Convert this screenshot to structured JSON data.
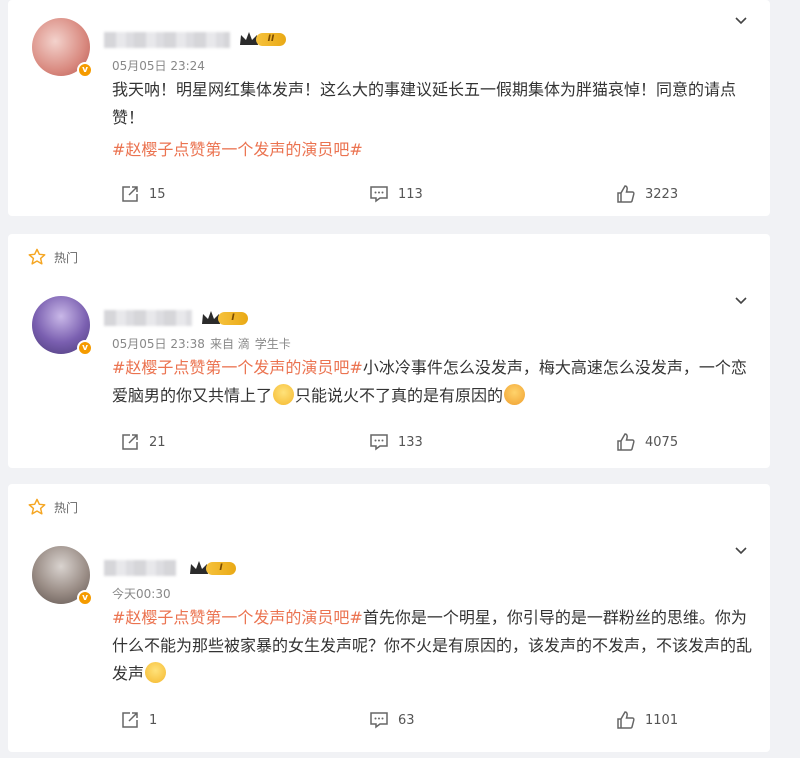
{
  "comments": [
    {
      "hot_label": "",
      "vip_text": "II",
      "time": "05月05日 23:24",
      "source": "",
      "device": "",
      "body_text": "我天呐！明星网红集体发声！这么大的事建议延长五一假期集体为胖猫哀悼！同意的请点赞！",
      "topic": "#赵樱子点赞第一个发声的演员吧#",
      "trail_1": "",
      "trail_2": "",
      "share_count": "15",
      "comment_count": "113",
      "like_count": "3223"
    },
    {
      "hot_label": "热门",
      "vip_text": "I",
      "time": "05月05日 23:38",
      "source": "来自 滴",
      "device": "学生卡",
      "topic": "#赵樱子点赞第一个发声的演员吧#",
      "body_text": "小冰冷事件怎么没发声，梅大高速怎么没发声，一个恋爱脑男的你又共情上了",
      "trail_1": "只能说火不了真的是有原因的",
      "trail_2": "",
      "share_count": "21",
      "comment_count": "133",
      "like_count": "4075"
    },
    {
      "hot_label": "热门",
      "vip_text": "I",
      "time": "今天00:30",
      "source": "",
      "device": "",
      "topic": "#赵樱子点赞第一个发声的演员吧#",
      "body_text": "首先你是一个明星，你引导的是一群粉丝的思维。你为什么不能为那些被家暴的女生发声呢？你不火是有原因的，该发声的不发声，不该发声的乱发声",
      "trail_1": "",
      "trail_2": "",
      "share_count": "1",
      "comment_count": "63",
      "like_count": "1101"
    }
  ],
  "colors": {
    "topic": "#eb7350",
    "background": "#f1f2f5",
    "verified_badge": "#f59b00",
    "hot_star": "#f5a623"
  },
  "icons": {
    "share": "share-icon",
    "comment": "comment-icon",
    "like": "like-icon",
    "more": "chevron-down-icon",
    "hot": "star-icon"
  }
}
